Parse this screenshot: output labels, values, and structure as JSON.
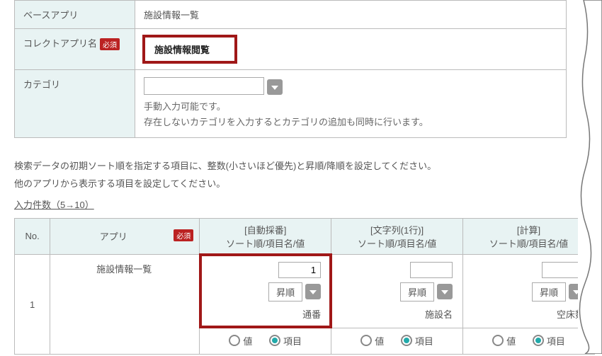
{
  "form": {
    "baseApp": {
      "label": "ベースアプリ",
      "value": "施設情報一覧"
    },
    "collectAppName": {
      "label": "コレクトアプリ名",
      "required": "必須",
      "value": "施設情報閲覧"
    },
    "category": {
      "label": "カテゴリ",
      "help1": "手動入力可能です。",
      "help2": "存在しないカテゴリを入力するとカテゴリの追加も同時に行います。"
    }
  },
  "instructions": {
    "line1": "検索データの初期ソート順を指定する項目に、整数(小さいほど優先)と昇順/降順を設定してください。",
    "line2": "他のアプリから表示する項目を設定してください。",
    "link": "入力件数（5→10）"
  },
  "table": {
    "headers": {
      "no": "No.",
      "app": "アプリ",
      "required": "必須",
      "col1": {
        "top": "[自動採番]",
        "bottom": "ソート順/項目名/値"
      },
      "col2": {
        "top": "[文字列(1行)]",
        "bottom": "ソート順/項目名/値"
      },
      "col3": {
        "top": "[計算]",
        "bottom": "ソート順/項目名/値"
      }
    },
    "row1": {
      "no": "1",
      "app": "施設情報一覧",
      "cells": [
        {
          "num": "1",
          "order": "昇順",
          "field": "通番"
        },
        {
          "num": "",
          "order": "昇順",
          "field": "施設名"
        },
        {
          "num": "",
          "order": "昇順",
          "field": "空床数"
        }
      ]
    },
    "radios": {
      "value": "値",
      "item": "項目"
    }
  }
}
